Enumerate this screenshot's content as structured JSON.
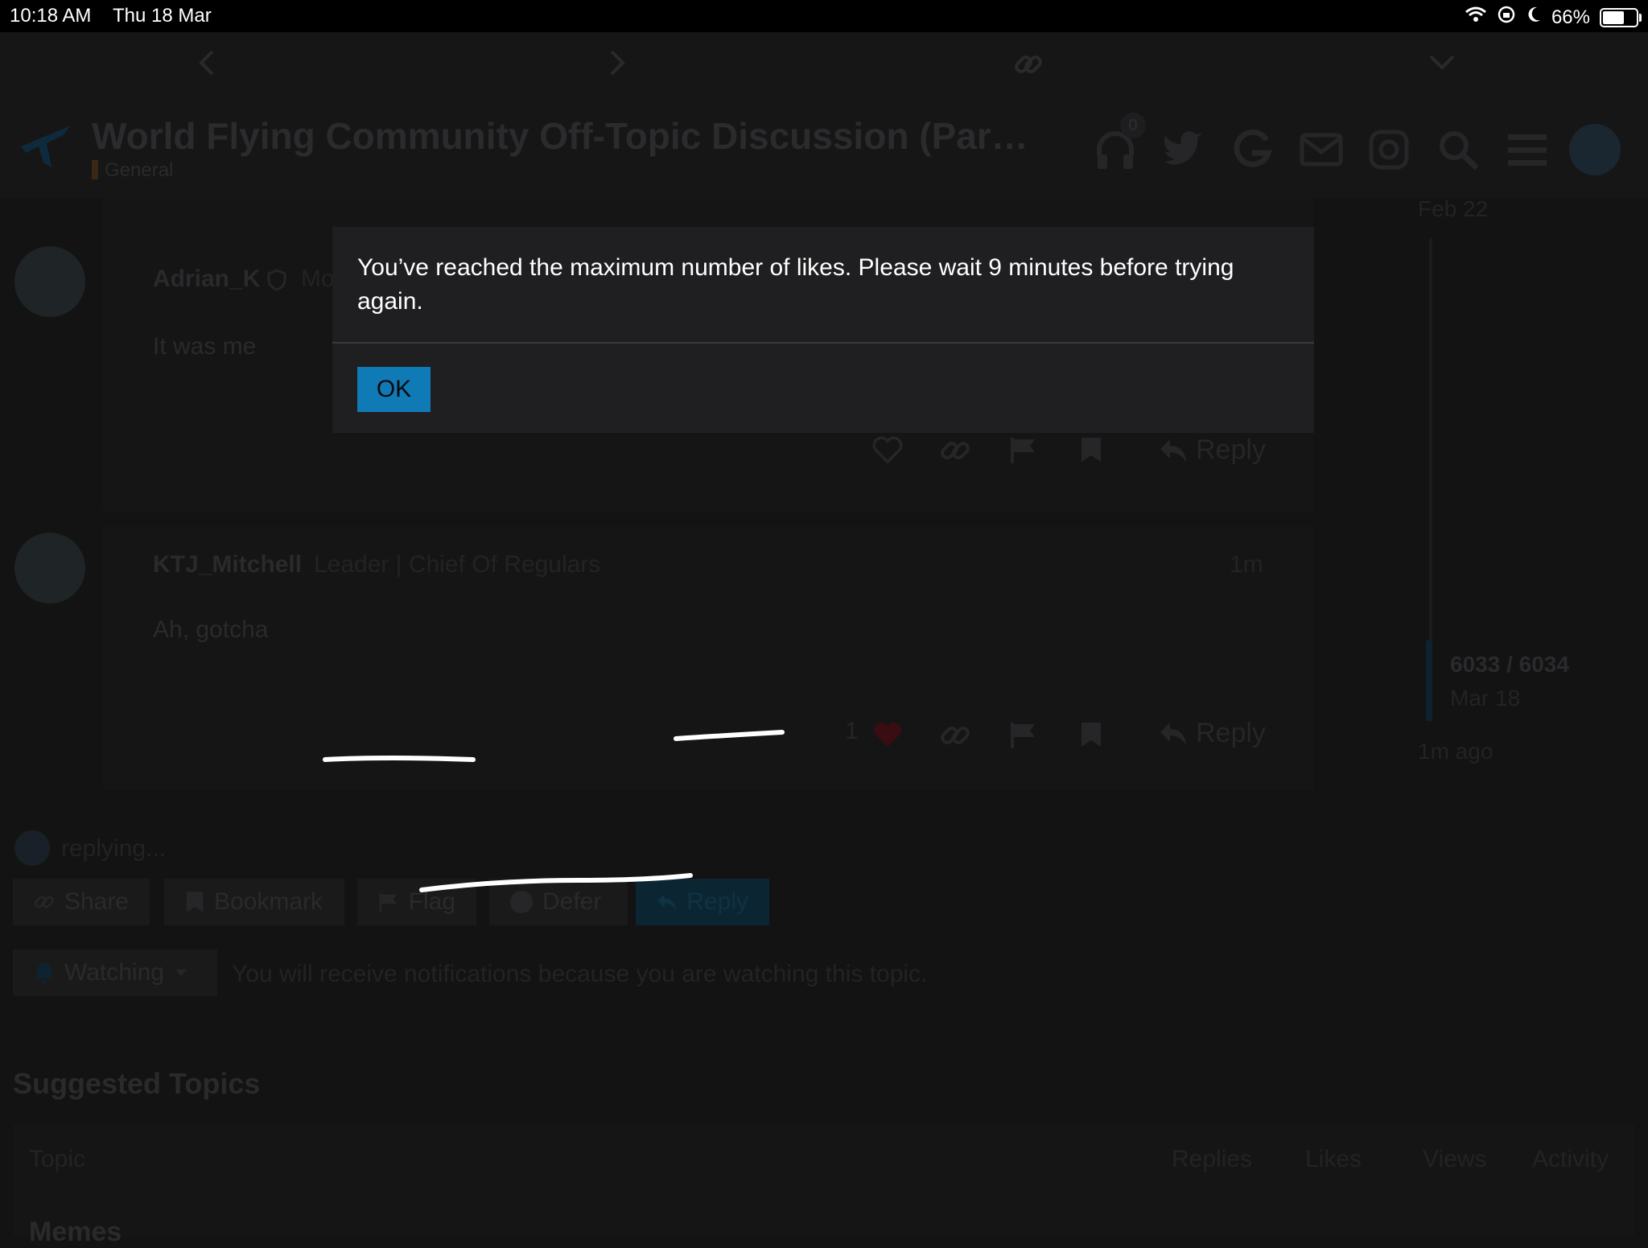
{
  "status_bar": {
    "time": "10:18 AM",
    "date": "Thu 18 Mar",
    "battery_percent": "66%",
    "battery_level": 0.66
  },
  "header": {
    "title": "World Flying Community Off-Topic Discussion (Par…",
    "category": "General",
    "notification_count": "0"
  },
  "timeline": {
    "top_date": "Feb 22",
    "position": "6033 / 6034",
    "bottom_date": "Mar 18",
    "last_activity": "1m ago"
  },
  "posts": [
    {
      "username": "Adrian_K",
      "user_title": "Mo",
      "body": "It was me",
      "reply_label": "Reply"
    },
    {
      "username": "KTJ_Mitchell",
      "user_title": "Leader | Chief Of Regulars",
      "time": "1m",
      "body": "Ah, gotcha",
      "like_count": "1",
      "reply_label": "Reply"
    }
  ],
  "composer": {
    "status": "replying..."
  },
  "footer_buttons": {
    "share": "Share",
    "bookmark": "Bookmark",
    "flag": "Flag",
    "defer": "Defer",
    "reply": "Reply"
  },
  "notifications": {
    "level": "Watching",
    "description": "You will receive notifications because you are watching this topic."
  },
  "suggested": {
    "heading": "Suggested Topics",
    "columns": [
      "Topic",
      "Replies",
      "Likes",
      "Views",
      "Activity"
    ],
    "first_row": "Memes"
  },
  "modal": {
    "message": "You’ve reached the maximum number of likes. Please wait 9 minutes before trying again.",
    "ok_label": "OK"
  }
}
